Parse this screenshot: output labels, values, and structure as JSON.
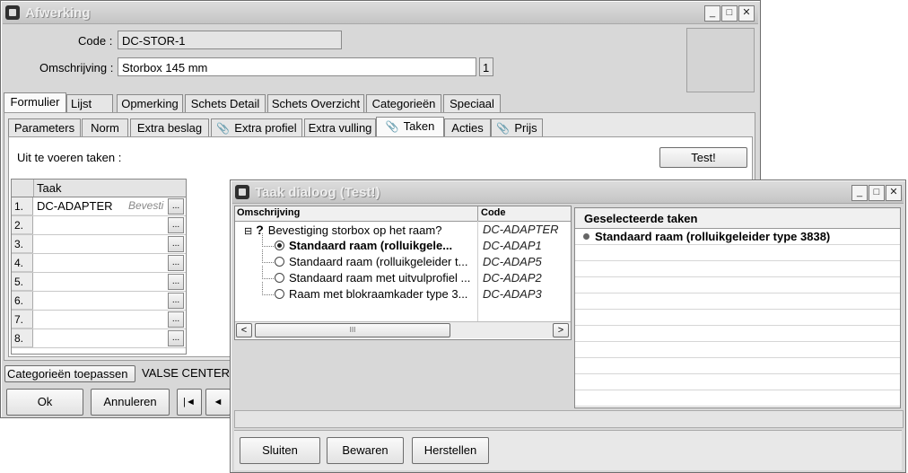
{
  "main_window": {
    "title": "Afwerking",
    "min": "_",
    "max": "□",
    "close": "✕",
    "code_label": "Code :",
    "code_value": "DC-STOR-1",
    "omschrijving_label": "Omschrijving :",
    "omschrijving_value": "Storbox 145 mm",
    "omschrijving_count": "1",
    "tabs": [
      "Formulier",
      "Lijst",
      "Opmerking",
      "Schets Detail",
      "Schets Overzicht",
      "Categorieën",
      "Speciaal"
    ],
    "subtabs": [
      "Parameters",
      "Norm",
      "Extra beslag",
      "Extra profiel",
      "Extra vulling",
      "Taken",
      "Acties",
      "Prijs"
    ],
    "uit_te_voeren_label": "Uit te voeren taken :",
    "test_button": "Test!",
    "grid": {
      "header": "Taak",
      "rows": [
        {
          "num": "1.",
          "task": "DC-ADAPTER",
          "extra": "Bevesti"
        },
        {
          "num": "2.",
          "task": "",
          "extra": ""
        },
        {
          "num": "3.",
          "task": "",
          "extra": ""
        },
        {
          "num": "4.",
          "task": "",
          "extra": ""
        },
        {
          "num": "5.",
          "task": "",
          "extra": ""
        },
        {
          "num": "6.",
          "task": "",
          "extra": ""
        },
        {
          "num": "7.",
          "task": "",
          "extra": ""
        },
        {
          "num": "8.",
          "task": "",
          "extra": ""
        }
      ],
      "dots": "..."
    },
    "categorieen_toepassen": "Categorieën toepassen",
    "valse_center": "VALSE CENTER",
    "ok_button": "Ok",
    "annuleren_button": "Annuleren",
    "nav_first": "|◄",
    "nav_prev": "◄"
  },
  "dialog": {
    "title": "Taak dialoog (Test!)",
    "min": "_",
    "max": "□",
    "close": "✕",
    "col_omschrijving": "Omschrijving",
    "col_code": "Code",
    "tree": [
      {
        "label": "Bevestiging storbox op het raam?",
        "code": "DC-ADAPTER",
        "type": "question"
      },
      {
        "label": "Standaard raam (rolluikgele...",
        "code": "DC-ADAP1",
        "type": "radio",
        "selected": true
      },
      {
        "label": "Standaard raam (rolluikgeleider t...",
        "code": "DC-ADAP5",
        "type": "radio",
        "selected": false
      },
      {
        "label": "Standaard raam met uitvulprofiel ...",
        "code": "DC-ADAP2",
        "type": "radio",
        "selected": false
      },
      {
        "label": "Raam met blokraamkader type 3...",
        "code": "DC-ADAP3",
        "type": "radio",
        "selected": false
      }
    ],
    "expand_symbol": "⊟",
    "question_symbol": "?",
    "scroll_left": "<",
    "scroll_right": ">",
    "scroll_grip": "III",
    "selected_header": "Geselecteerde taken",
    "selected_items": [
      "Standaard raam (rolluikgeleider type 3838)"
    ],
    "sluiten_button": "Sluiten",
    "bewaren_button": "Bewaren",
    "herstellen_button": "Herstellen"
  }
}
